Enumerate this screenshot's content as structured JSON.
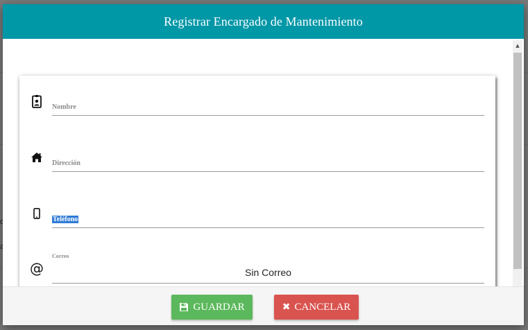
{
  "background": {
    "fragments": [
      "o",
      "a"
    ]
  },
  "modal": {
    "title": "Registrar Encargado de Mantenimiento",
    "header_color": "#0097a7"
  },
  "form": {
    "fields": [
      {
        "icon": "id-badge-icon",
        "label": "Nombre",
        "value": ""
      },
      {
        "icon": "home-icon",
        "label": "Dirección",
        "value": ""
      },
      {
        "icon": "mobile-phone-icon",
        "label": "Teléfono",
        "value": "",
        "selected": true
      },
      {
        "icon": "at-sign-icon",
        "icon_glyph": "@",
        "label": "Correo",
        "value": "Sin Correo"
      }
    ]
  },
  "footer": {
    "save_label": "GUARDAR",
    "save_icon": "floppy-disk-icon",
    "cancel_label": "CANCELAR",
    "cancel_icon": "times-icon",
    "cancel_glyph": "✖",
    "save_color": "#5cb85c",
    "cancel_color": "#d9534f"
  }
}
